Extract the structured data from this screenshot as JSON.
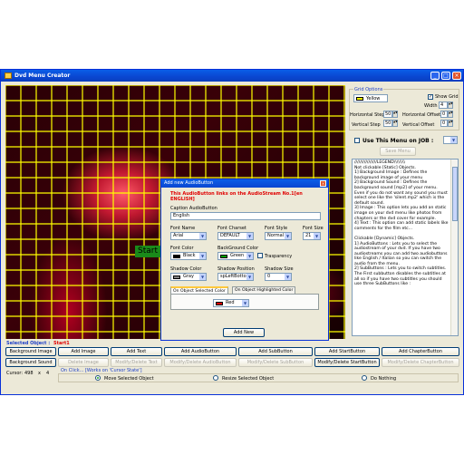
{
  "window": {
    "title": "Dvd Menu Creator",
    "minimize": "_",
    "maximize": "□",
    "close": "×"
  },
  "canvas": {
    "start_label": "Start"
  },
  "grid_options": {
    "legend": "Grid Options",
    "color_label": "Yellow",
    "color_value": "#ffff00",
    "show_grid_label": "Show Grid",
    "show_grid_checked": "✓",
    "width_label": "Width",
    "width_value": "4",
    "h_step_label": "Horizontal Step",
    "h_step_value": "50",
    "h_offset_label": "Horizontal Offset",
    "h_offset_value": "0",
    "v_step_label": "Vertical Step",
    "v_step_value": "50",
    "v_offset_label": "Vertical Offset",
    "v_offset_value": "0"
  },
  "use_menu": {
    "label": "Use This Menu on JOB :",
    "save_button": "Save Menu"
  },
  "legend_text": "////////////////LEGEND\\\\\\\\\\\\\\\\\nNot clickable [Static] Objects.\n1] Background Image : Defines the background image of your menu\n2] Background Sound : Defines the background sound [mp2] of your menu. Even if you do not want any sound you must select one like the 'silent.mp2' which is the default sound.\n3] Image : This option lets you add an static image on your dvd menu like photos from chapters or the dvd cover for example.\n4] Text : This option can add static labels like comments for the film etc...\n\nClickable [Dynamic] Objects.\n1] AudioButtons : Lets you to select the audiostream of your dvd. If you have two audiostreams you can add two audiobuttons like English / Italian so you can switch the audio from the menu.\n2] SubButtons : Lets you to switch subtitles. The First subbutton disables the subtitles at all so if you have two subtitles you should use three SubButtons like :",
  "dialog": {
    "title": "Add new AudioButton",
    "header": "This AudioButton links on the AudioStream No.1[en ENGLISH]",
    "caption_label": "Caption AudioButton",
    "caption_value": "English",
    "font_name_label": "Font Name",
    "font_name_value": "Arial",
    "font_charset_label": "Font Charset",
    "font_charset_value": "DEFAULT",
    "font_style_label": "Font Style",
    "font_style_value": "Normal",
    "font_size_label": "Font Size",
    "font_size_value": "21",
    "font_color_label": "Font Color",
    "font_color_value": "Black",
    "font_color_swatch": "#000000",
    "bg_color_label": "BackGround Color",
    "bg_color_value": "Green",
    "bg_color_swatch": "#00a000",
    "transparency_label": "Trasparency",
    "shadow_color_label": "Shadow Color",
    "shadow_color_value": "Gray",
    "shadow_color_swatch": "#808080",
    "shadow_position_label": "Shadow Position",
    "shadow_position_value": "spLeftBottom",
    "shadow_size_label": "Shadow Size",
    "shadow_size_value": "0",
    "tab_selected": "On Object Selected Color",
    "tab_highlighted": "On Object Highlighted Color",
    "selected_color_value": "Red",
    "selected_color_swatch": "#e00000",
    "add_button": "Add New"
  },
  "bottom": {
    "selected_label": "Selected Object :",
    "selected_value": "Start1",
    "background_image": "Background Image",
    "background_sound": "Background Sound",
    "add_image": "Add Image",
    "delete_image": "Delete Image",
    "add_text": "Add Text",
    "modify_delete_text": "Modify/Delete Text",
    "add_audiobutton": "Add AudioButton",
    "modify_delete_audiobutton": "Modify/Delete AudioButton",
    "add_subbutton": "Add SubButton",
    "modify_delete_subbutton": "Modify/Delete SubButton",
    "add_startbutton": "Add StartButton",
    "modify_delete_startbutton": "Modify/Delete StartButton",
    "add_chapterbutton": "Add ChapterButton",
    "modify_delete_chapterbutton": "Modify/Delete ChapterButton",
    "cursor_label": "Cursor:",
    "cursor_x": "498",
    "cursor_sep": "x",
    "cursor_y": "4",
    "onclick_label": "On Click... [Works on 'Cursor State']",
    "move_selected": "Move Selected Object",
    "resize_selected": "Resize Selected Object",
    "do_nothing": "Do Nothing"
  }
}
